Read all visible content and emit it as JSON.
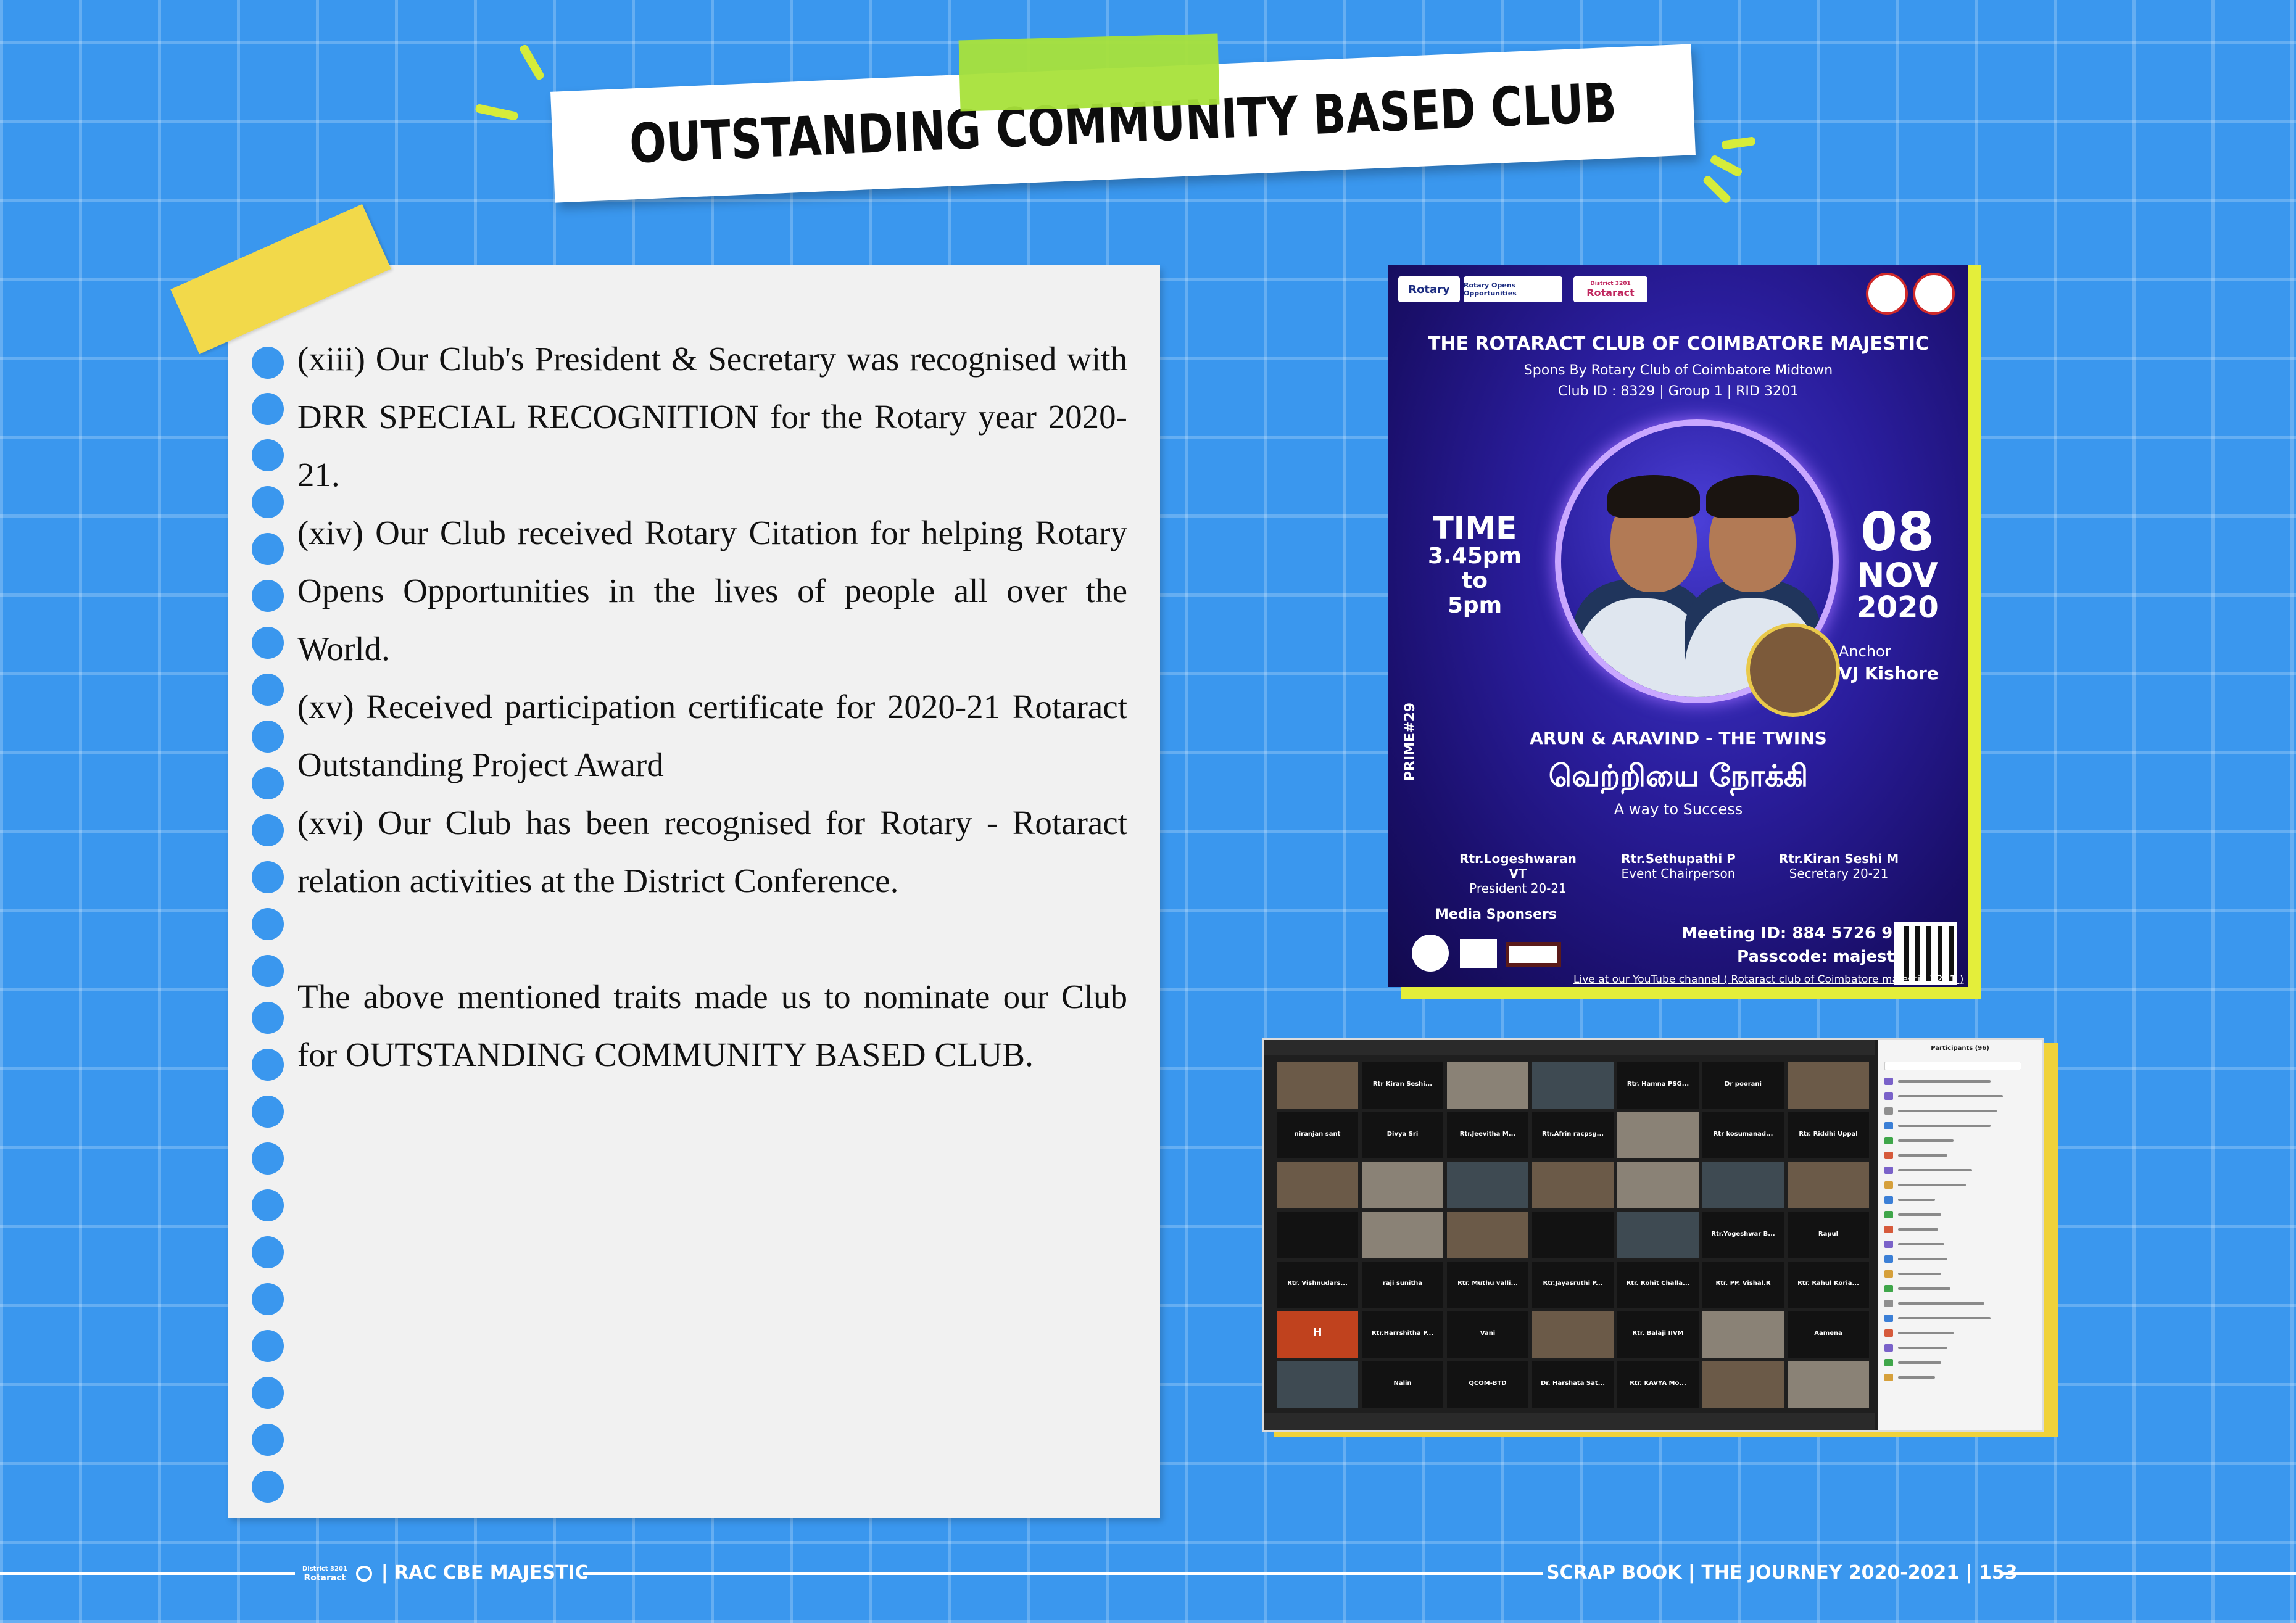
{
  "title": "OUTSTANDING COMMUNITY BASED CLUB",
  "paper": {
    "paragraphs": [
      "(xiii) Our Club's President & Secretary was recognised with DRR SPECIAL RECOGNITION for the Rotary year 2020-21.",
      "(xiv) Our Club received Rotary Citation for helping Rotary Opens Opportunities in the lives of people all over the World.",
      "(xv)  Received participation certificate for 2020-21 Rotaract Outstanding Project Award",
      "(xvi)  Our Club has been recognised for Rotary - Rotaract relation activities at the District Conference.",
      "The above mentioned traits made us to nominate our Club for OUTSTANDING COMMUNITY BASED CLUB."
    ]
  },
  "poster": {
    "logo_rotary": "Rotary",
    "logo_roo": "Rotary Opens Opportunities",
    "logo_district": "District 3201",
    "logo_rotaract": "Rotaract",
    "club_name": "THE ROTARACT CLUB OF COIMBATORE MAJESTIC",
    "sponsor": "Spons By Rotary Club of Coimbatore Midtown",
    "club_id": "Club ID : 8329 | Group 1 | RID 3201",
    "time_label": "TIME",
    "time_value_1": "3.45pm",
    "time_value_2": "to",
    "time_value_3": "5pm",
    "date_day": "08",
    "date_month": "NOV",
    "date_year": "2020",
    "anchor_label": "Anchor",
    "anchor_name": "VJ Kishore",
    "prime_tag": "PRIME#29",
    "speakers": "ARUN & ARAVIND - THE TWINS",
    "tamil_title": "வெற்றியை நோக்கி",
    "subtitle": "A way to Success",
    "people": [
      {
        "name": "Rtr.Logeshwaran VT",
        "role": "President 20-21"
      },
      {
        "name": "Rtr.Sethupathi P",
        "role": "Event Chairperson"
      },
      {
        "name": "Rtr.Kiran Seshi M",
        "role": "Secretary 20-21"
      }
    ],
    "media_label": "Media Sponsers",
    "meeting_id": "Meeting ID: 884 5726 9332",
    "passcode": "Passcode: majestic",
    "youtube": "Live at our YouTube channel ( Rotaract club of Coimbatore majestic 3201 )"
  },
  "zoom": {
    "panel_title": "Participants (96)",
    "tiles": [
      "",
      "Rtr Kiran Seshi...",
      "",
      "",
      "Rtr. Hamna PSG...",
      "Dr poorani",
      "",
      "niranjan sant",
      "Divya Sri",
      "Rtr.Jeevitha M...",
      "Rtr.Afrin racpsg...",
      "",
      "Rtr kosumanad...",
      "Rtr. Riddhi Uppal",
      "",
      "",
      "",
      "",
      "",
      "",
      "",
      "",
      "",
      "",
      "",
      "",
      "Rtr.Yogeshwar B...",
      "Rapul",
      "Rtr. Vishnudars...",
      "raji sunitha",
      "Rtr. Muthu valli...",
      "Rtr.Jayasruthi P...",
      "Rtr. Rohit Challa...",
      "Rtr. PP. Vishal.R",
      "Rtr. Rahul Koria...",
      "H",
      "Rtr.Harrshitha P...",
      "Vani",
      "",
      "Rtr. Balaji IIVM",
      "",
      "Aamena",
      "",
      "Nalin",
      "QCOM-BTD",
      "Dr. Harshata Sat...",
      "Rtr. KAVYA  Mo...",
      "",
      ""
    ]
  },
  "footer": {
    "left_logo_small": "District 3201",
    "left_logo": "Rotaract",
    "left_text": "| RAC CBE MAJESTIC",
    "right_text": "SCRAP BOOK | THE JOURNEY 2020-2021 | 153"
  }
}
